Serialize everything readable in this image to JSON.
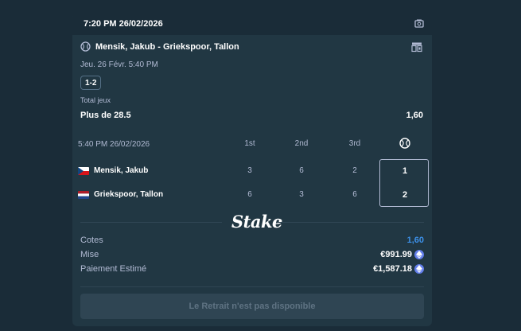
{
  "header": {
    "timestamp": "7:20 PM 26/02/2026",
    "icon": "ticket-icon"
  },
  "match": {
    "title": "Mensik, Jakub - Griekspoor, Tallon",
    "sport_icon": "tennis-ball-icon",
    "side_icon": "bet-slip-icon",
    "date": "Jeu. 26 Févr.  5:40 PM",
    "score": "1-2"
  },
  "bet": {
    "market": "Total jeux",
    "selection": "Plus de 28.5",
    "odds": "1,60"
  },
  "scoreboard": {
    "time": "5:40 PM 26/02/2026",
    "columns": [
      "1st",
      "2nd",
      "3rd"
    ],
    "sets_icon": "tennis-ball-icon",
    "players": [
      {
        "name": "Mensik, Jakub",
        "flag": "czech-flag",
        "games": [
          "3",
          "6",
          "2"
        ],
        "sets": "1"
      },
      {
        "name": "Griekspoor, Tallon",
        "flag": "netherlands-flag",
        "games": [
          "6",
          "3",
          "6"
        ],
        "sets": "2"
      }
    ]
  },
  "brand": {
    "logo": "Stake"
  },
  "summary": {
    "odds_label": "Cotes",
    "odds_value": "1,60",
    "stake_label": "Mise",
    "stake_value": "€991.99",
    "payout_label": "Paiement Estimé",
    "payout_value": "€1,587.18",
    "currency_icon": "ethereum-icon"
  },
  "actions": {
    "withdraw_label": "Le Retrait n'est pas disponible"
  },
  "colors": {
    "background": "#1a2c38",
    "card": "#213743",
    "muted_text": "#b1bad3",
    "accent_blue": "#3c8fe6",
    "eth": "#627eea"
  }
}
